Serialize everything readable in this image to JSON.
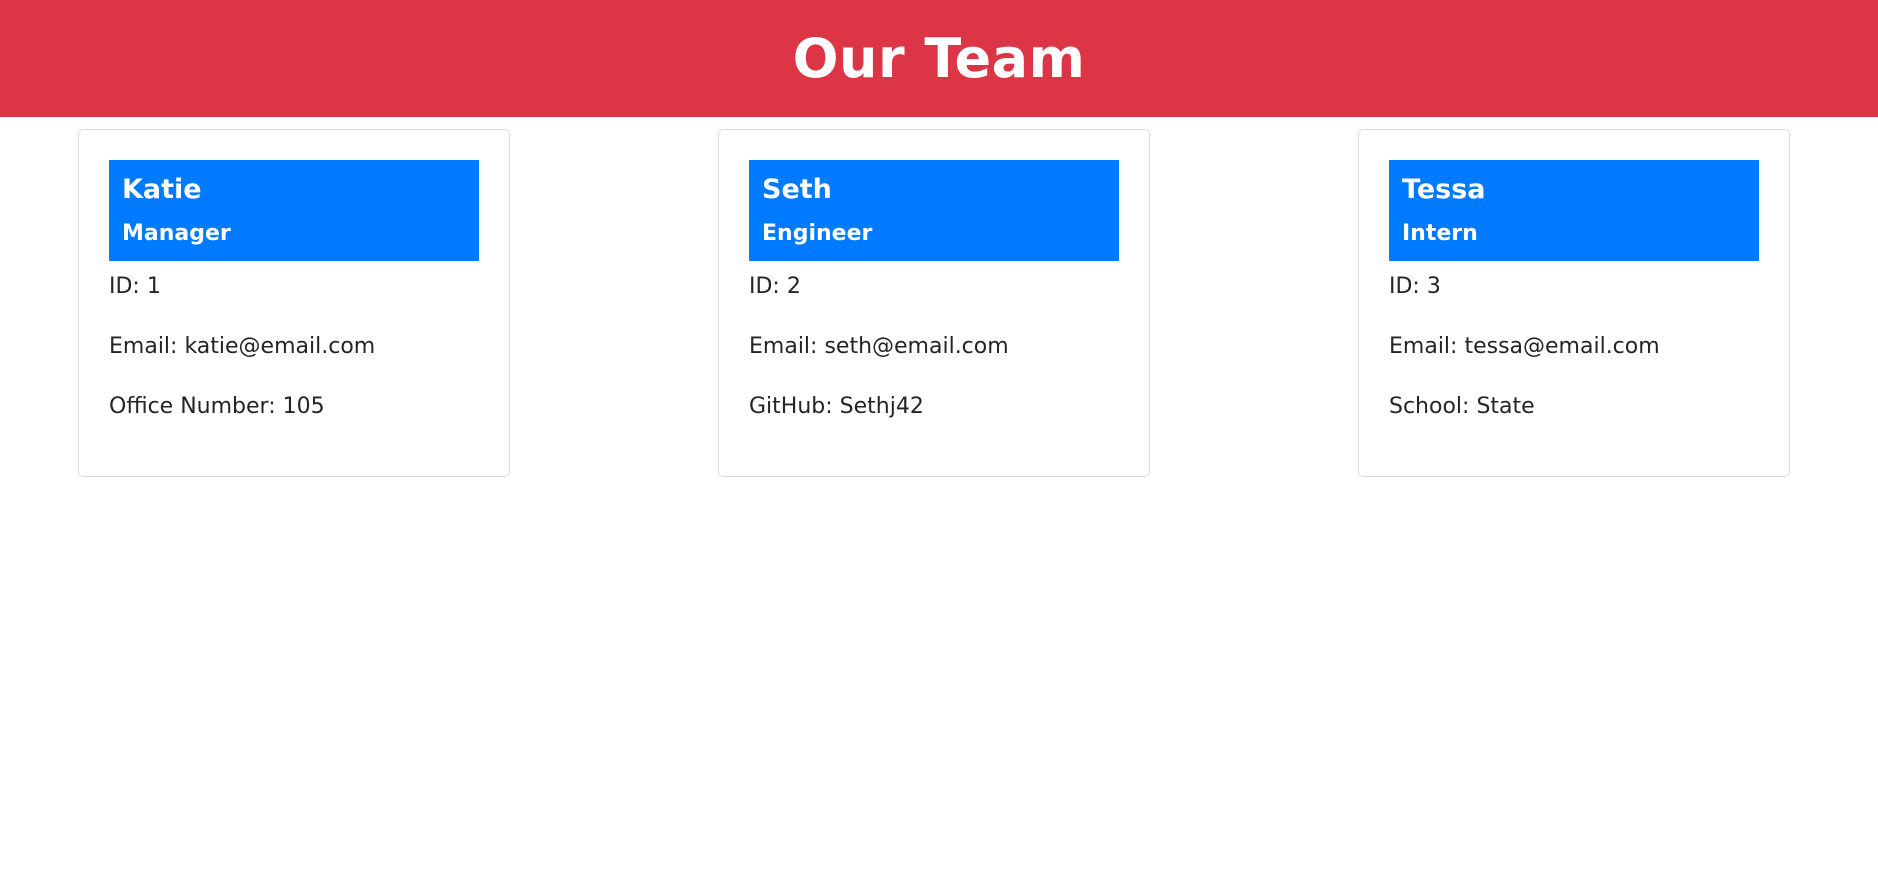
{
  "page": {
    "title": "Our Team"
  },
  "colors": {
    "header_bg": "#dc3545",
    "card_header_bg": "#007bff",
    "text": "#212529"
  },
  "team": [
    {
      "name": "Katie",
      "role": "Manager",
      "id_label": "ID:",
      "id": "1",
      "email_label": "Email:",
      "email": "katie@email.com",
      "extra_label": "Office Number:",
      "extra_value": "105"
    },
    {
      "name": "Seth",
      "role": "Engineer",
      "id_label": "ID:",
      "id": "2",
      "email_label": "Email:",
      "email": "seth@email.com",
      "extra_label": "GitHub:",
      "extra_value": "Sethj42"
    },
    {
      "name": "Tessa",
      "role": "Intern",
      "id_label": "ID:",
      "id": "3",
      "email_label": "Email:",
      "email": "tessa@email.com",
      "extra_label": "School:",
      "extra_value": "State"
    }
  ]
}
